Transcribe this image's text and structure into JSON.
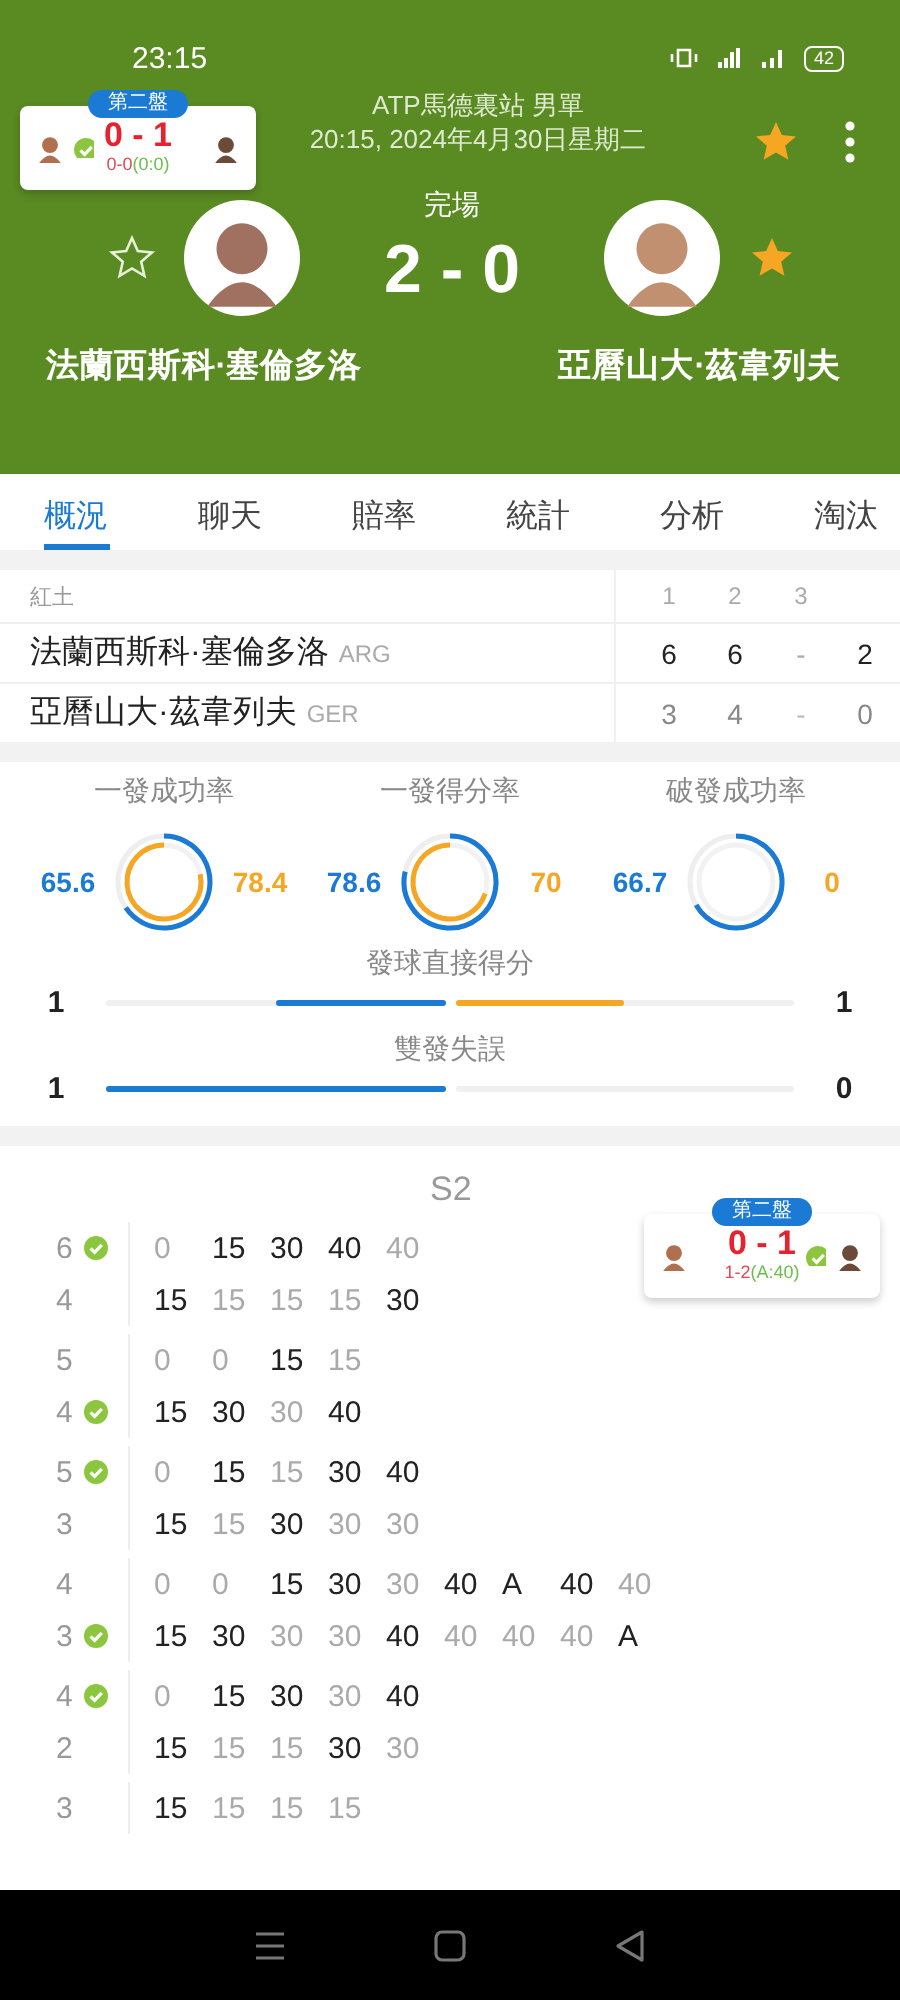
{
  "status_bar": {
    "time": "23:15",
    "battery": "42"
  },
  "mini_scoreboard": {
    "badge": "第二盤",
    "score": "0 - 1",
    "game": "0-0",
    "points": "(0:0)",
    "home_serving": true,
    "away_serving": false
  },
  "header": {
    "tournament": "ATP馬德裏站 男單",
    "datetime": "20:15, 2024年4月30日星期二",
    "favorite": true,
    "status": "完場",
    "score": "2 - 0",
    "players": [
      {
        "name": "法蘭西斯科·塞倫多洛",
        "favorite": false
      },
      {
        "name": "亞曆山大·茲韋列夫",
        "favorite": true
      }
    ]
  },
  "tabs": [
    {
      "label": "概況",
      "selected": true
    },
    {
      "label": "聊天",
      "selected": false
    },
    {
      "label": "賠率",
      "selected": false
    },
    {
      "label": "統計",
      "selected": false
    },
    {
      "label": "分析",
      "selected": false
    },
    {
      "label": "淘汰",
      "selected": false
    }
  ],
  "set_table": {
    "surface": "紅土",
    "columns": [
      "1",
      "2",
      "3"
    ],
    "rows": [
      {
        "name": "法蘭西斯科·塞倫多洛",
        "country": "ARG",
        "sets": [
          "6",
          "6",
          "-"
        ],
        "total": "2",
        "winner": true
      },
      {
        "name": "亞曆山大·茲韋列夫",
        "country": "GER",
        "sets": [
          "3",
          "4",
          "-"
        ],
        "total": "0",
        "winner": false
      }
    ]
  },
  "stats": {
    "rings": [
      {
        "label": "一發成功率",
        "home": "65.6",
        "away": "78.4"
      },
      {
        "label": "一發得分率",
        "home": "78.6",
        "away": "70"
      },
      {
        "label": "破發成功率",
        "home": "66.7",
        "away": "0"
      }
    ],
    "bars": [
      {
        "label": "發球直接得分",
        "home": "1",
        "away": "1"
      },
      {
        "label": "雙發失誤",
        "home": "1",
        "away": "0"
      }
    ]
  },
  "point_by_point": {
    "title": "S2",
    "games": [
      {
        "rows": [
          {
            "score": "6",
            "served": true,
            "points": [
              {
                "v": "0",
                "won": false
              },
              {
                "v": "15",
                "won": true
              },
              {
                "v": "30",
                "won": true
              },
              {
                "v": "40",
                "won": true
              },
              {
                "v": "40",
                "won": false
              }
            ]
          },
          {
            "score": "4",
            "served": false,
            "points": [
              {
                "v": "15",
                "won": true
              },
              {
                "v": "15",
                "won": false
              },
              {
                "v": "15",
                "won": false
              },
              {
                "v": "15",
                "won": false
              },
              {
                "v": "30",
                "won": true
              }
            ]
          }
        ]
      },
      {
        "rows": [
          {
            "score": "5",
            "served": false,
            "points": [
              {
                "v": "0",
                "won": false
              },
              {
                "v": "0",
                "won": false
              },
              {
                "v": "15",
                "won": true
              },
              {
                "v": "15",
                "won": false
              }
            ]
          },
          {
            "score": "4",
            "served": true,
            "points": [
              {
                "v": "15",
                "won": true
              },
              {
                "v": "30",
                "won": true
              },
              {
                "v": "30",
                "won": false
              },
              {
                "v": "40",
                "won": true
              }
            ]
          }
        ]
      },
      {
        "rows": [
          {
            "score": "5",
            "served": true,
            "points": [
              {
                "v": "0",
                "won": false
              },
              {
                "v": "15",
                "won": true
              },
              {
                "v": "15",
                "won": false
              },
              {
                "v": "30",
                "won": true
              },
              {
                "v": "40",
                "won": true
              }
            ]
          },
          {
            "score": "3",
            "served": false,
            "points": [
              {
                "v": "15",
                "won": true
              },
              {
                "v": "15",
                "won": false
              },
              {
                "v": "30",
                "won": true
              },
              {
                "v": "30",
                "won": false
              },
              {
                "v": "30",
                "won": false
              }
            ]
          }
        ]
      },
      {
        "rows": [
          {
            "score": "4",
            "served": false,
            "points": [
              {
                "v": "0",
                "won": false
              },
              {
                "v": "0",
                "won": false
              },
              {
                "v": "15",
                "won": true
              },
              {
                "v": "30",
                "won": true
              },
              {
                "v": "30",
                "won": false
              },
              {
                "v": "40",
                "won": true
              },
              {
                "v": "A",
                "won": true
              },
              {
                "v": "40",
                "won": true
              },
              {
                "v": "40",
                "won": false
              }
            ]
          },
          {
            "score": "3",
            "served": true,
            "points": [
              {
                "v": "15",
                "won": true
              },
              {
                "v": "30",
                "won": true
              },
              {
                "v": "30",
                "won": false
              },
              {
                "v": "30",
                "won": false
              },
              {
                "v": "40",
                "won": true
              },
              {
                "v": "40",
                "won": false
              },
              {
                "v": "40",
                "won": false
              },
              {
                "v": "40",
                "won": false
              },
              {
                "v": "A",
                "won": true
              }
            ]
          }
        ]
      },
      {
        "rows": [
          {
            "score": "4",
            "served": true,
            "points": [
              {
                "v": "0",
                "won": false
              },
              {
                "v": "15",
                "won": true
              },
              {
                "v": "30",
                "won": true
              },
              {
                "v": "30",
                "won": false
              },
              {
                "v": "40",
                "won": true
              }
            ]
          },
          {
            "score": "2",
            "served": false,
            "points": [
              {
                "v": "15",
                "won": true
              },
              {
                "v": "15",
                "won": false
              },
              {
                "v": "15",
                "won": false
              },
              {
                "v": "30",
                "won": true
              },
              {
                "v": "30",
                "won": false
              }
            ]
          }
        ]
      },
      {
        "rows": [
          {
            "score": "3",
            "served": false,
            "points": [
              {
                "v": "15",
                "won": true
              },
              {
                "v": "15",
                "won": false
              },
              {
                "v": "15",
                "won": false
              },
              {
                "v": "15",
                "won": false
              }
            ]
          }
        ]
      }
    ],
    "floating_scoreboard": {
      "badge": "第二盤",
      "score": "0 - 1",
      "game": "1-2",
      "points": "(A:40)",
      "home_serving": false,
      "away_serving": true
    }
  }
}
